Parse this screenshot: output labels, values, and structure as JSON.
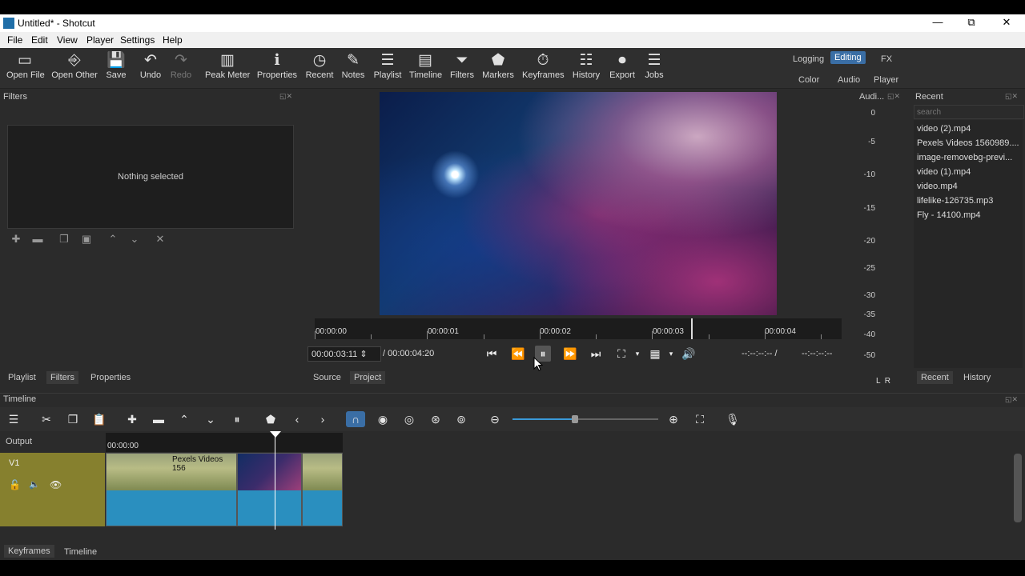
{
  "window": {
    "title": "Untitled* - Shotcut",
    "minimize": "—",
    "maximize": "⧉",
    "close": "✕"
  },
  "menu": [
    "File",
    "Edit",
    "View",
    "Player",
    "Settings",
    "Help"
  ],
  "toolbar": [
    {
      "label": "Open File",
      "icon": "open-file-icon",
      "glyph": "▭"
    },
    {
      "label": "Open Other",
      "icon": "open-other-icon",
      "glyph": "⎆"
    },
    {
      "label": "Save",
      "icon": "save-icon",
      "glyph": "💾"
    },
    {
      "label": "Undo",
      "icon": "undo-icon",
      "glyph": "↶"
    },
    {
      "label": "Redo",
      "icon": "redo-icon",
      "glyph": "↷"
    },
    {
      "label": "Peak Meter",
      "icon": "peak-meter-icon",
      "glyph": "▥"
    },
    {
      "label": "Properties",
      "icon": "properties-icon",
      "glyph": "ℹ"
    },
    {
      "label": "Recent",
      "icon": "recent-icon",
      "glyph": "◷"
    },
    {
      "label": "Notes",
      "icon": "notes-icon",
      "glyph": "✎"
    },
    {
      "label": "Playlist",
      "icon": "playlist-icon",
      "glyph": "☰"
    },
    {
      "label": "Timeline",
      "icon": "timeline-icon",
      "glyph": "▤"
    },
    {
      "label": "Filters",
      "icon": "filters-icon",
      "glyph": "⏷"
    },
    {
      "label": "Markers",
      "icon": "markers-icon",
      "glyph": "⬟"
    },
    {
      "label": "Keyframes",
      "icon": "keyframes-icon",
      "glyph": "⏱"
    },
    {
      "label": "History",
      "icon": "history-icon",
      "glyph": "☷"
    },
    {
      "label": "Export",
      "icon": "export-icon",
      "glyph": "⏺"
    },
    {
      "label": "Jobs",
      "icon": "jobs-icon",
      "glyph": "☰"
    }
  ],
  "layouts": {
    "row1": [
      "Logging",
      "Editing",
      "FX"
    ],
    "row2": [
      "Color",
      "Audio",
      "Player"
    ],
    "active": "Editing"
  },
  "filters_panel": {
    "title": "Filters",
    "empty": "Nothing selected",
    "tabs": [
      "Playlist",
      "Filters",
      "Properties"
    ]
  },
  "player": {
    "ruler_labels": [
      "00:00:00",
      "00:00:01",
      "00:00:02",
      "00:00:03",
      "00:00:04"
    ],
    "current_time": "00:00:03:11",
    "total_time": "/ 00:00:04:20",
    "in_point": "--:--:--:-- /",
    "out_point": "--:--:--:--",
    "tabs": [
      "Source",
      "Project"
    ]
  },
  "audio_meter": {
    "title": "Audi...",
    "labels": [
      "0",
      "-5",
      "-10",
      "-15",
      "-20",
      "-25",
      "-30",
      "-35",
      "-40",
      "-50"
    ],
    "channels": "L  R"
  },
  "recent": {
    "title": "Recent",
    "search_placeholder": "search",
    "items": [
      "video (2).mp4",
      "Pexels Videos 1560989....",
      "image-removebg-previ...",
      "video (1).mp4",
      "video.mp4",
      "lifelike-126735.mp3",
      "Fly - 14100.mp4"
    ],
    "tabs": [
      "Recent",
      "History"
    ]
  },
  "timeline": {
    "title": "Timeline",
    "output_label": "Output",
    "track": "V1",
    "ruler_start": "00:00:00",
    "clip_label": "Pexels Videos 156",
    "playhead_position": "00:00:03:11"
  },
  "bottom_tabs": [
    "Keyframes",
    "Timeline"
  ],
  "colors": {
    "accent": "#3a6ea5",
    "track_header": "#86802e",
    "clip_audio": "#2a8fbf",
    "panel_bg": "#2b2b2b"
  }
}
